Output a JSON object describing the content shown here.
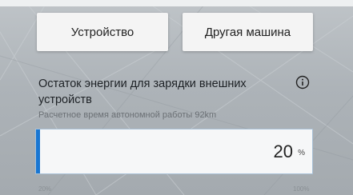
{
  "buttons": {
    "device_label": "Устройство",
    "other_car_label": "Другая машина"
  },
  "energy": {
    "title": "Остаток энергии для зарядки внешних устройств",
    "subtitle": "Расчетное время автономной работы 92km",
    "value": "20",
    "unit": "%",
    "fill_percent": 20,
    "scale_min": "20%",
    "scale_max": "100%"
  },
  "icons": {
    "info": "info-icon"
  },
  "colors": {
    "accent": "#1976d2",
    "button_bg": "#f4f4f4",
    "text": "#222222"
  }
}
